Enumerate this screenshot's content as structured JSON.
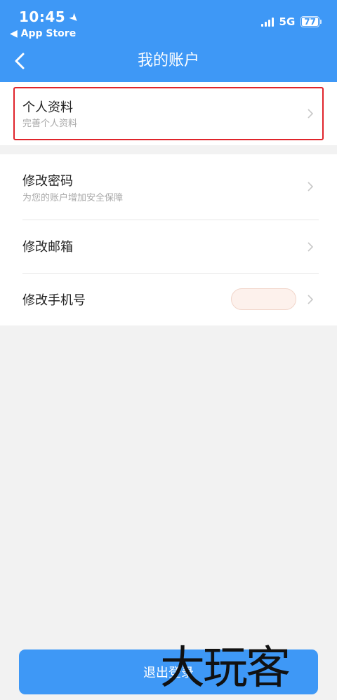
{
  "status_bar": {
    "time": "10:45",
    "back_app": "◀ App Store",
    "network": "5G",
    "battery": "77"
  },
  "nav": {
    "title": "我的账户"
  },
  "profile": {
    "title": "个人资料",
    "subtitle": "完善个人资料"
  },
  "settings": [
    {
      "title": "修改密码",
      "subtitle": "为您的账户增加安全保障"
    },
    {
      "title": "修改邮箱"
    },
    {
      "title": "修改手机号"
    }
  ],
  "logout_label": "退出登录",
  "watermark": "大玩客",
  "colors": {
    "accent": "#3e98f6",
    "highlight": "#e0242b"
  }
}
